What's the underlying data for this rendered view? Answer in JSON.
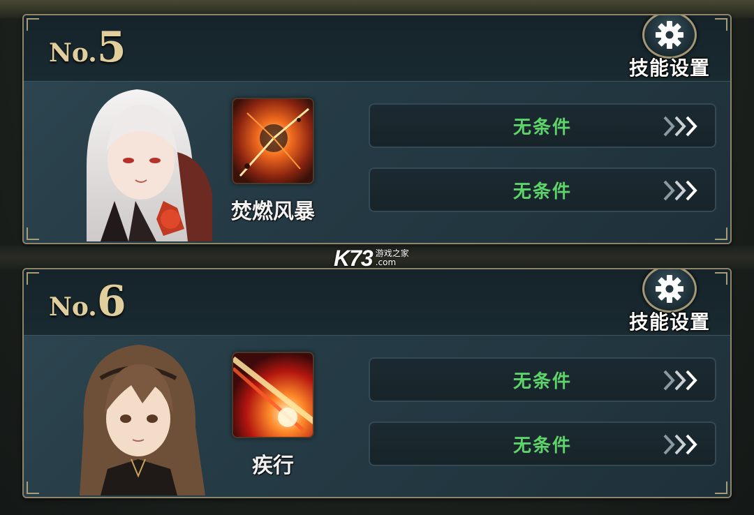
{
  "watermark": {
    "brand": "K73",
    "site": "游戏之家",
    "domain": ".com"
  },
  "cards": [
    {
      "no_label": "No.",
      "number": "5",
      "settings_label": "技能设置",
      "skill_name": "焚燃风暴",
      "conditions": [
        "无条件",
        "无条件"
      ]
    },
    {
      "no_label": "No.",
      "number": "6",
      "settings_label": "技能设置",
      "skill_name": "疾行",
      "conditions": [
        "无条件",
        "无条件"
      ]
    }
  ],
  "icons": {
    "settings": "gear-icon",
    "condition_arrow": "triple-chevron-right-icon"
  },
  "colors": {
    "condition_text": "#5ed36a",
    "card_border": "#8f866a",
    "number_gold": "#e0cf9c"
  }
}
